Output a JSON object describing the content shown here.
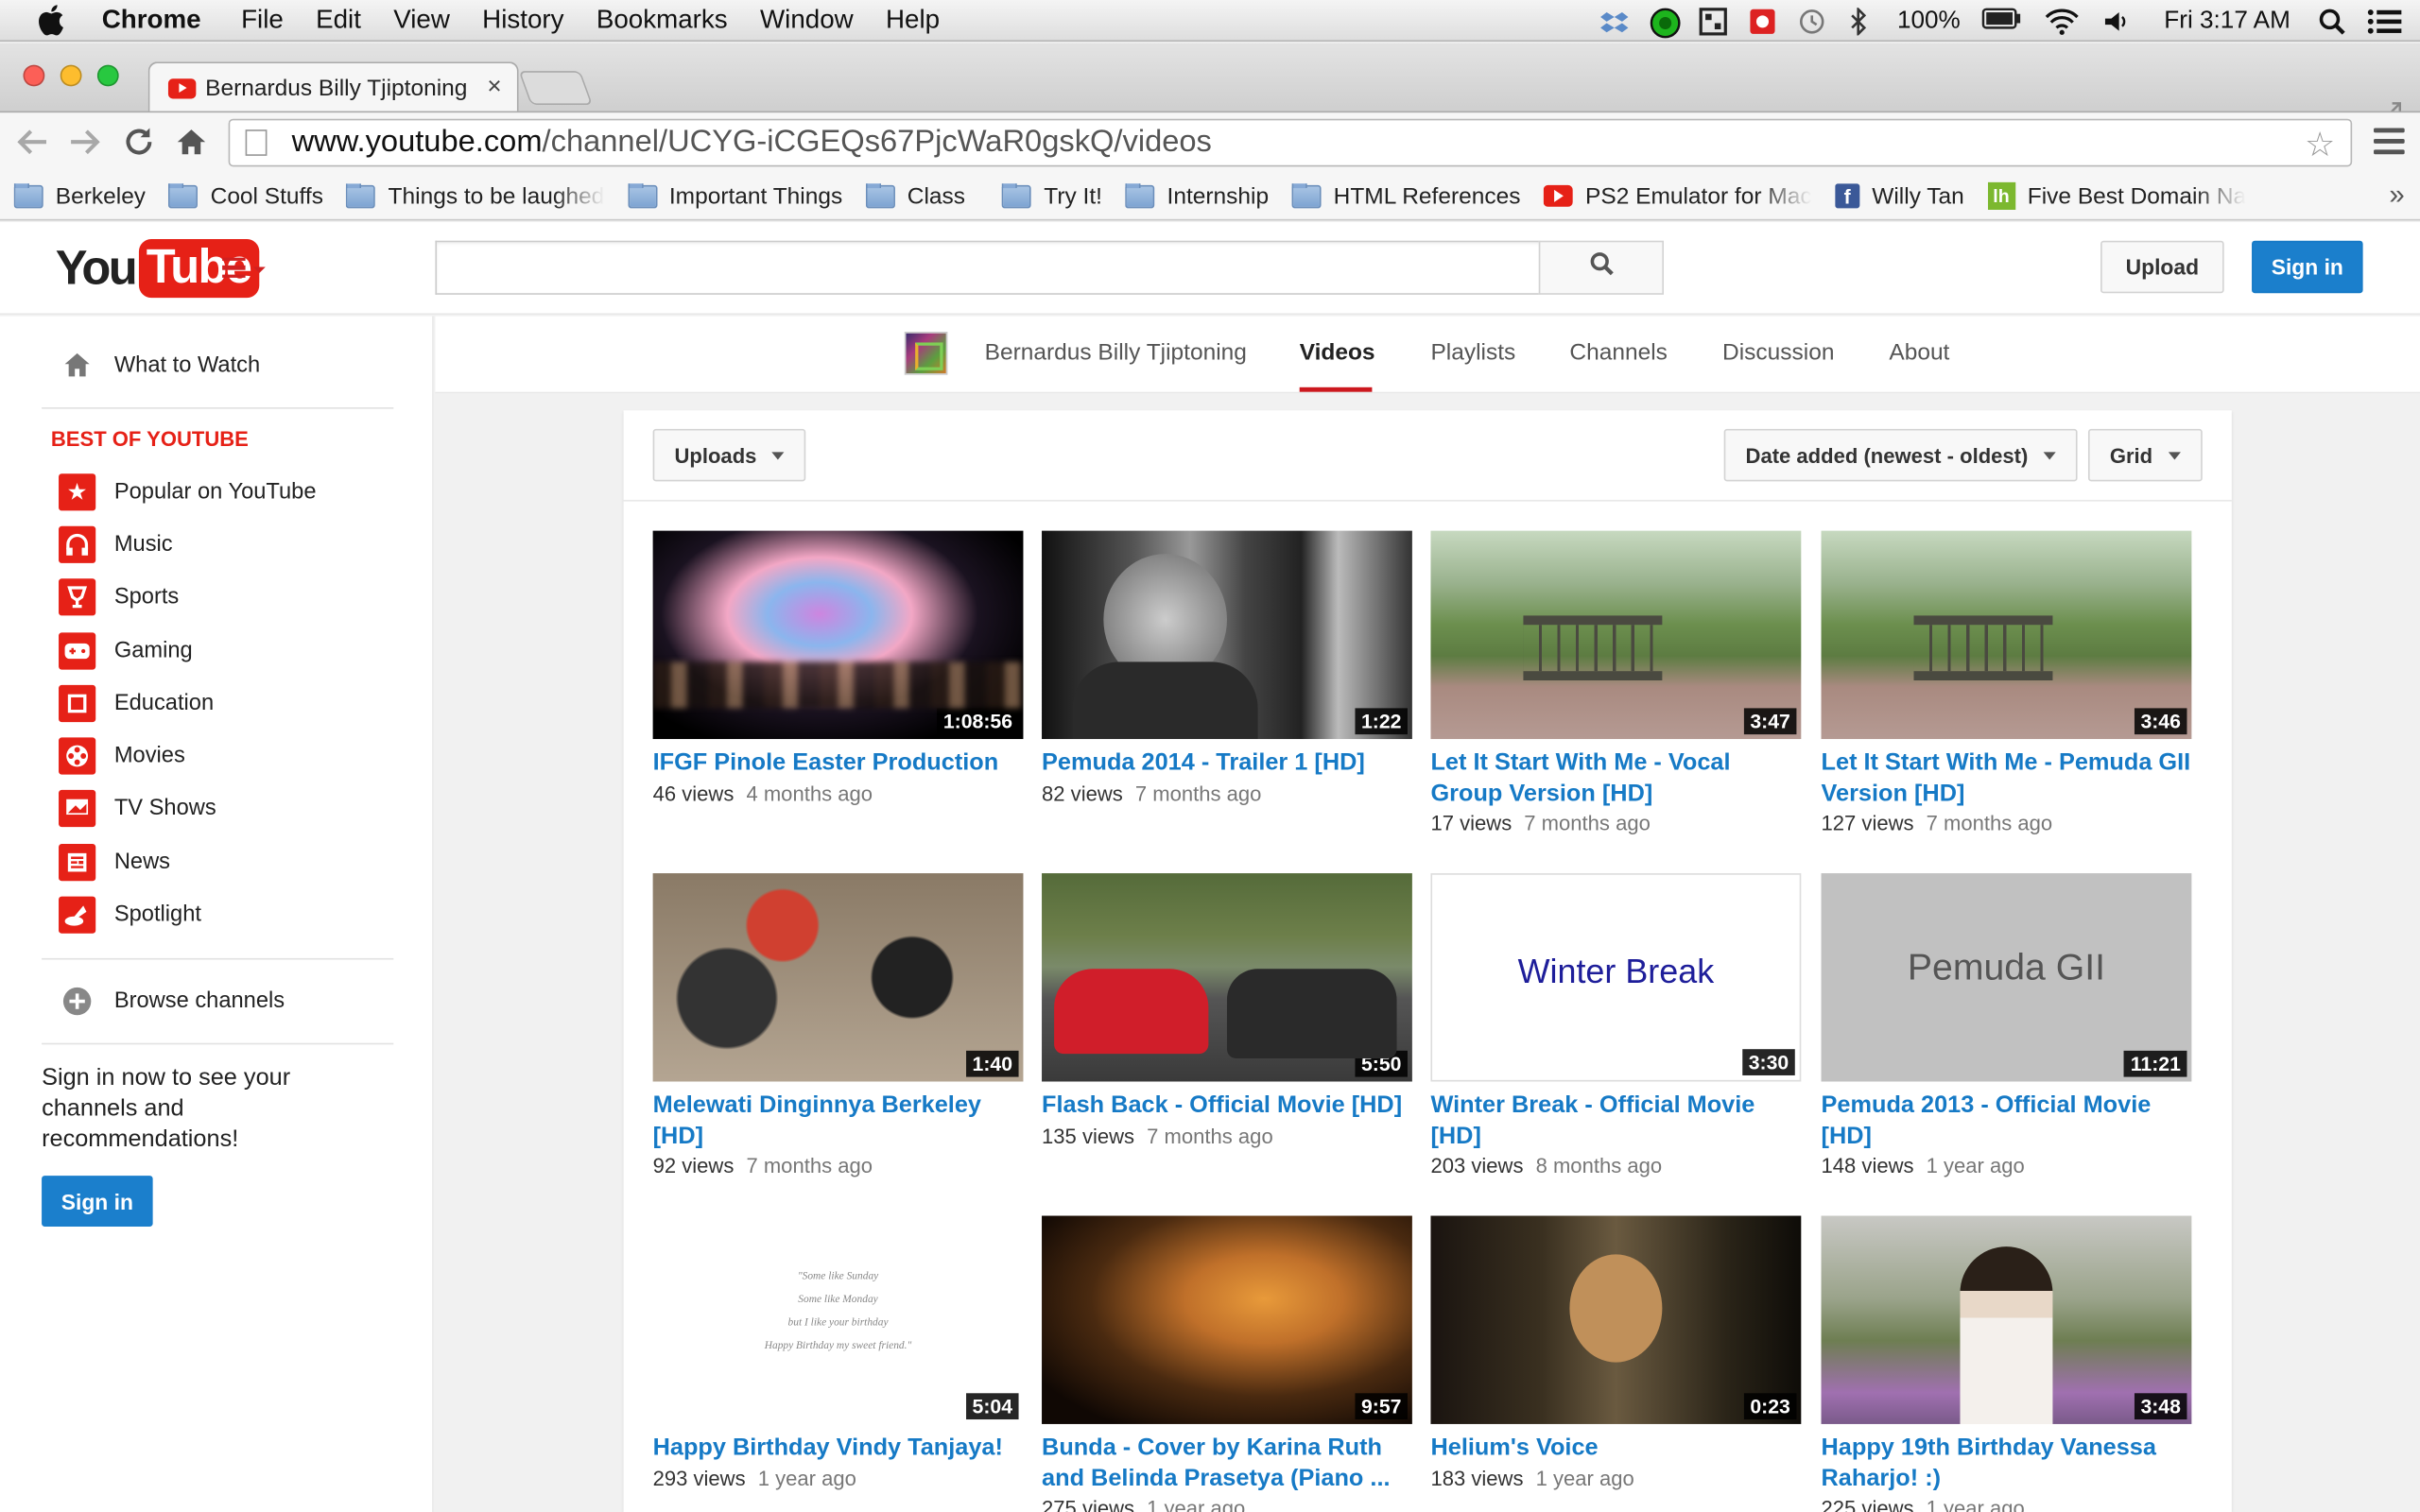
{
  "menubar": {
    "app": "Chrome",
    "items": [
      "File",
      "Edit",
      "View",
      "History",
      "Bookmarks",
      "Window",
      "Help"
    ],
    "battery": "100%",
    "clock": "Fri 3:17 AM"
  },
  "tab": {
    "title": "Bernardus Billy Tjiptoning",
    "close": "×"
  },
  "omnibox": {
    "host": "www.youtube.com",
    "path": "/channel/UCYG-iCGEQs67PjcWaR0gskQ/videos"
  },
  "bookmarks": [
    {
      "label": "Berkeley",
      "icon": "folder"
    },
    {
      "label": "Cool Stuffs",
      "icon": "folder"
    },
    {
      "label": "Things to be laughed",
      "icon": "folder"
    },
    {
      "label": "Important Things",
      "icon": "folder"
    },
    {
      "label": "Class",
      "icon": "folder"
    },
    {
      "label": "Try It!",
      "icon": "folder"
    },
    {
      "label": "Internship",
      "icon": "folder"
    },
    {
      "label": "HTML References",
      "icon": "folder"
    },
    {
      "label": "PS2 Emulator for Mac",
      "icon": "youtube"
    },
    {
      "label": "Willy Tan",
      "icon": "facebook"
    },
    {
      "label": "Five Best Domain Na",
      "icon": "lh"
    }
  ],
  "header": {
    "upload": "Upload",
    "signin": "Sign in",
    "search_placeholder": ""
  },
  "guide": {
    "what_to_watch": "What to Watch",
    "section": "BEST OF YOUTUBE",
    "categories": [
      "Popular on YouTube",
      "Music",
      "Sports",
      "Gaming",
      "Education",
      "Movies",
      "TV Shows",
      "News",
      "Spotlight"
    ],
    "browse": "Browse channels",
    "signin_text": "Sign in now to see your channels and recommendations!",
    "signin_button": "Sign in"
  },
  "channel": {
    "name": "Bernardus Billy Tjiptoning",
    "tabs": [
      "Videos",
      "Playlists",
      "Channels",
      "Discussion",
      "About"
    ],
    "active_tab": "Videos"
  },
  "filters": {
    "uploads": "Uploads",
    "sort": "Date added (newest - oldest)",
    "view": "Grid"
  },
  "videos": [
    {
      "title": "IFGF Pinole Easter Production",
      "views": "46 views",
      "ago": "4 months ago",
      "duration": "1:08:56"
    },
    {
      "title": "Pemuda 2014 - Trailer 1 [HD]",
      "views": "82 views",
      "ago": "7 months ago",
      "duration": "1:22"
    },
    {
      "title": "Let It Start With Me - Vocal Group Version [HD]",
      "views": "17 views",
      "ago": "7 months ago",
      "duration": "3:47"
    },
    {
      "title": "Let It Start With Me - Pemuda GII Version [HD]",
      "views": "127 views",
      "ago": "7 months ago",
      "duration": "3:46"
    },
    {
      "title": "Melewati Dinginnya Berkeley [HD]",
      "views": "92 views",
      "ago": "7 months ago",
      "duration": "1:40"
    },
    {
      "title": "Flash Back - Official Movie [HD]",
      "views": "135 views",
      "ago": "7 months ago",
      "duration": "5:50"
    },
    {
      "title": "Winter Break - Official Movie [HD]",
      "views": "203 views",
      "ago": "8 months ago",
      "duration": "3:30",
      "thumb_text": "Winter Break"
    },
    {
      "title": "Pemuda 2013 - Official Movie [HD]",
      "views": "148 views",
      "ago": "1 year ago",
      "duration": "11:21",
      "thumb_text": "Pemuda GII"
    },
    {
      "title": "Happy Birthday Vindy Tanjaya!",
      "views": "293 views",
      "ago": "1 year ago",
      "duration": "5:04",
      "thumb_lines": [
        "\"Some like Sunday",
        "Some like Monday",
        "but I like your birthday",
        "Happy Birthday my sweet friend.\""
      ]
    },
    {
      "title": "Bunda - Cover by Karina Ruth and Belinda Prasetya (Piano ...",
      "views": "275 views",
      "ago": "1 year ago",
      "duration": "9:57"
    },
    {
      "title": "Helium's Voice",
      "views": "183 views",
      "ago": "1 year ago",
      "duration": "0:23"
    },
    {
      "title": "Happy 19th Birthday Vanessa Raharjo! :)",
      "views": "225 views",
      "ago": "1 year ago",
      "duration": "3:48"
    }
  ]
}
